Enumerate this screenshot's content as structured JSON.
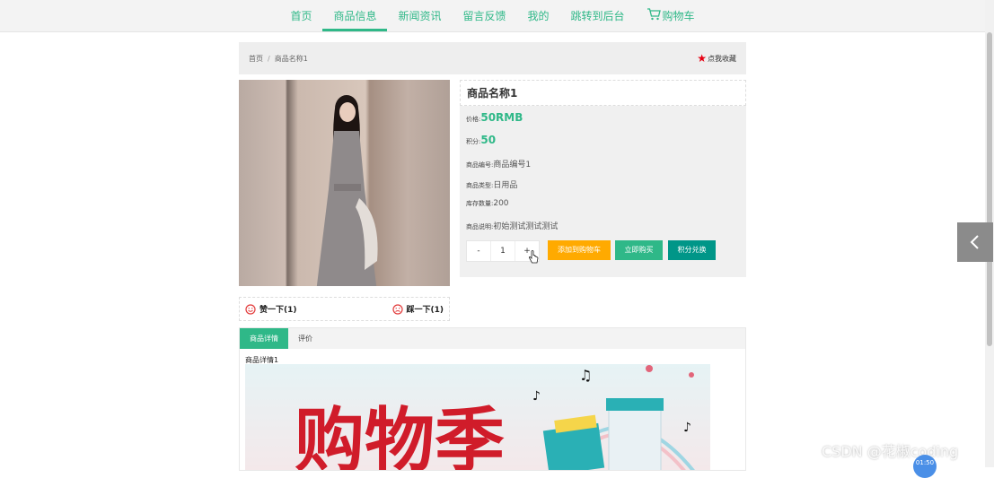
{
  "nav": {
    "items": [
      "首页",
      "商品信息",
      "新闻资讯",
      "留言反馈",
      "我的",
      "跳转到后台",
      "购物车"
    ],
    "active_index": 1
  },
  "breadcrumb": {
    "home": "首页",
    "separator": "/",
    "current": "商品名称1"
  },
  "favorite": {
    "label": "点我收藏"
  },
  "product": {
    "name": "商品名称1",
    "price_label": "价格:",
    "price": "50RMB",
    "points_label": "积分:",
    "points": "50",
    "code_label": "商品编号:",
    "code": "商品编号1",
    "type_label": "商品类型:",
    "type": "日用品",
    "stock_label": "库存数量:",
    "stock": "200",
    "desc_label": "商品说明:",
    "desc": "初始测试测试测试"
  },
  "quantity": {
    "minus": "-",
    "value": "1",
    "plus": "+"
  },
  "buttons": {
    "add_cart": "添加到购物车",
    "buy_now": "立即购买",
    "redeem": "积分兑换"
  },
  "votes": {
    "like": "赞一下(1)",
    "dislike": "踩一下(1)"
  },
  "tabs": {
    "detail": "商品详情",
    "review": "评价"
  },
  "detail": {
    "text": "商品详情1"
  },
  "banner": {
    "text": "购物季"
  },
  "watermark": "CSDN @花椒coding",
  "floater": "01:50",
  "colors": {
    "accent": "#2fb888",
    "orange": "#ffaa00",
    "teal": "#009688",
    "gray_panel": "#f0f0f0"
  }
}
